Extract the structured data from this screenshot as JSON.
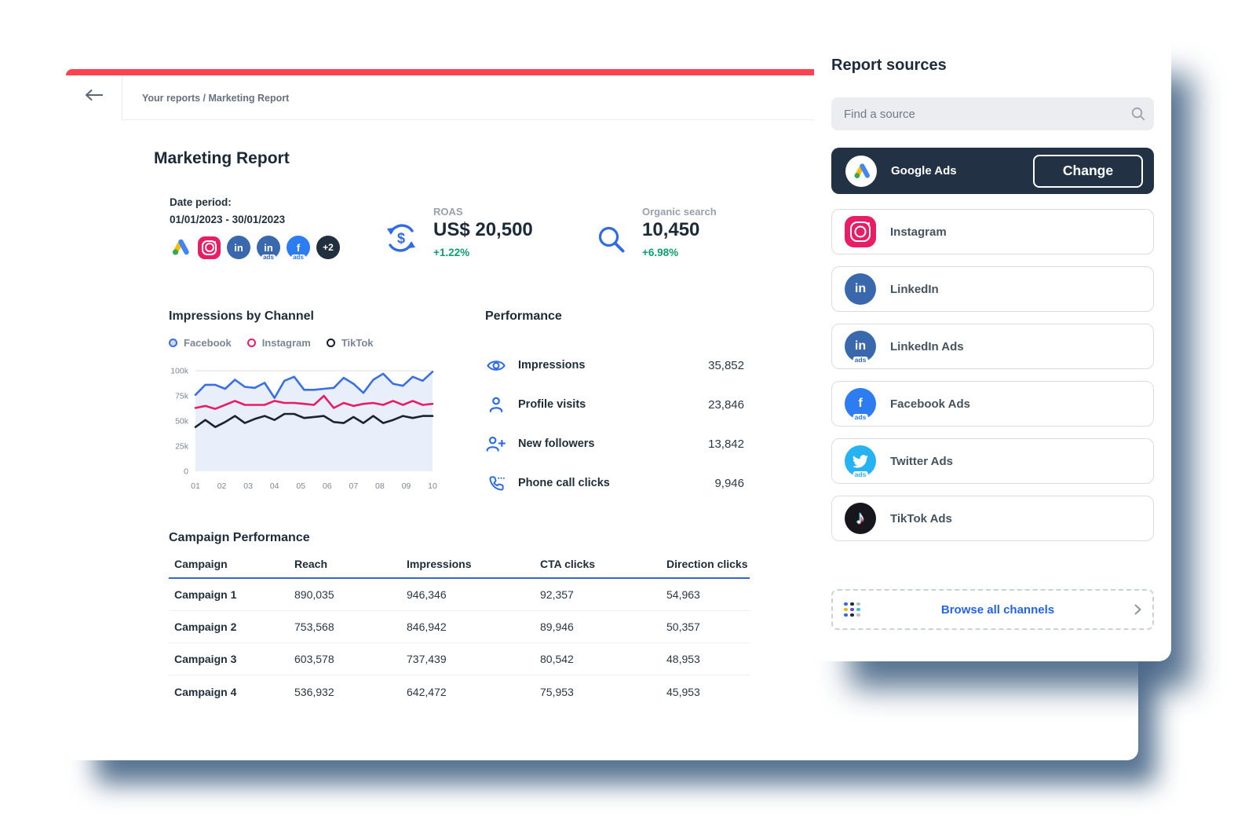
{
  "main": {
    "breadcrumb": "Your reports / Marketing Report",
    "title": "Marketing Report",
    "date_period": {
      "label": "Date period:",
      "value": "01/01/2023 - 30/01/2023"
    },
    "avatar_row": {
      "icons": [
        "google-ads-icon",
        "instagram-icon",
        "linkedin-icon",
        "linkedin-ads-icon",
        "facebook-ads-icon"
      ],
      "more_badge": "+2"
    },
    "stats": [
      {
        "label": "ROAS",
        "value": "US$ 20,500",
        "delta": "+1.22%",
        "icon": "dollar-sync-icon"
      },
      {
        "label": "Organic search",
        "value": "10,450",
        "delta": "+6.98%",
        "icon": "search-icon"
      }
    ],
    "performance": {
      "title": "Performance",
      "items": [
        {
          "label": "Impressions",
          "value": "35,852",
          "icon": "eye-icon"
        },
        {
          "label": "Profile visits",
          "value": "23,846",
          "icon": "person-icon"
        },
        {
          "label": "New followers",
          "value": "13,842",
          "icon": "person-plus-icon"
        },
        {
          "label": "Phone call clicks",
          "value": "9,946",
          "icon": "phone-icon"
        }
      ]
    },
    "campaign_table": {
      "title": "Campaign Performance",
      "columns": [
        "Campaign",
        "Reach",
        "Impressions",
        "CTA clicks",
        "Direction clicks"
      ],
      "rows": [
        {
          "cells": [
            "Campaign 1",
            "890,035",
            "946,346",
            "92,357",
            "54,963"
          ]
        },
        {
          "cells": [
            "Campaign 2",
            "753,568",
            "846,942",
            "89,946",
            "50,357"
          ]
        },
        {
          "cells": [
            "Campaign 3",
            "603,578",
            "737,439",
            "80,542",
            "48,953"
          ]
        },
        {
          "cells": [
            "Campaign 4",
            "536,932",
            "642,472",
            "75,953",
            "45,953"
          ]
        }
      ]
    }
  },
  "chart_data": {
    "type": "line",
    "title": "Impressions by Channel",
    "legend": [
      "Facebook",
      "Instagram",
      "TikTok"
    ],
    "legend_position": "top",
    "grid": "top-line-only",
    "ylim_k": [
      0,
      100
    ],
    "y_tick_labels": [
      "0",
      "25k",
      "50k",
      "75k",
      "100k"
    ],
    "x_tick_labels": [
      "01",
      "02",
      "03",
      "04",
      "05",
      "06",
      "07",
      "08",
      "09",
      "10"
    ],
    "values_unit": "thousands of impressions",
    "series": [
      {
        "name": "Facebook",
        "color": "#3a6fe2",
        "fill": "#e9eefb",
        "values_k": [
          76,
          86,
          86,
          82,
          91,
          84,
          83,
          88,
          73,
          90,
          94,
          81,
          81,
          82,
          83,
          93,
          87,
          78,
          91,
          97,
          87,
          85,
          94,
          90,
          99
        ]
      },
      {
        "name": "Instagram",
        "color": "#e81d62",
        "values_k": [
          63,
          65,
          62,
          66,
          70,
          66,
          66,
          66,
          70,
          68,
          68,
          67,
          66,
          75,
          63,
          68,
          65,
          67,
          68,
          66,
          70,
          66,
          70,
          66,
          67
        ]
      },
      {
        "name": "TikTok",
        "color": "#19242f",
        "values_k": [
          44,
          51,
          44,
          49,
          55,
          48,
          52,
          55,
          51,
          57,
          57,
          53,
          54,
          55,
          49,
          48,
          54,
          48,
          55,
          48,
          51,
          55,
          53,
          55,
          55
        ]
      }
    ]
  },
  "sources_panel": {
    "title": "Report sources",
    "search_placeholder": "Find a source",
    "selected": {
      "label": "Google Ads",
      "button_label": "Change",
      "icon": "google-ads-icon"
    },
    "items": [
      {
        "label": "Instagram",
        "icon": "instagram-icon"
      },
      {
        "label": "LinkedIn",
        "icon": "linkedin-icon"
      },
      {
        "label": "LinkedIn Ads",
        "icon": "linkedin-ads-icon"
      },
      {
        "label": "Facebook Ads",
        "icon": "facebook-ads-icon"
      },
      {
        "label": "Twitter Ads",
        "icon": "twitter-ads-icon"
      },
      {
        "label": "TikTok Ads",
        "icon": "tiktok-ads-icon"
      }
    ],
    "browse_label": "Browse all channels"
  },
  "glyphs": {
    "linkedin": "in",
    "facebook": "f",
    "ads": "ads",
    "tiktok": "♪",
    "plus_badge": "+2",
    "dollar": "$"
  },
  "colors": {
    "accent_red": "#fc4251",
    "accent_blue": "#2e6be5",
    "green_delta": "#0d9f6e",
    "navy_text": "#1b2936",
    "selected_row_bg": "#223144",
    "facebook_line": "#3a6fe2",
    "instagram_line": "#e81d62",
    "tiktok_line": "#19242f",
    "browse_link": "#2563e8"
  }
}
